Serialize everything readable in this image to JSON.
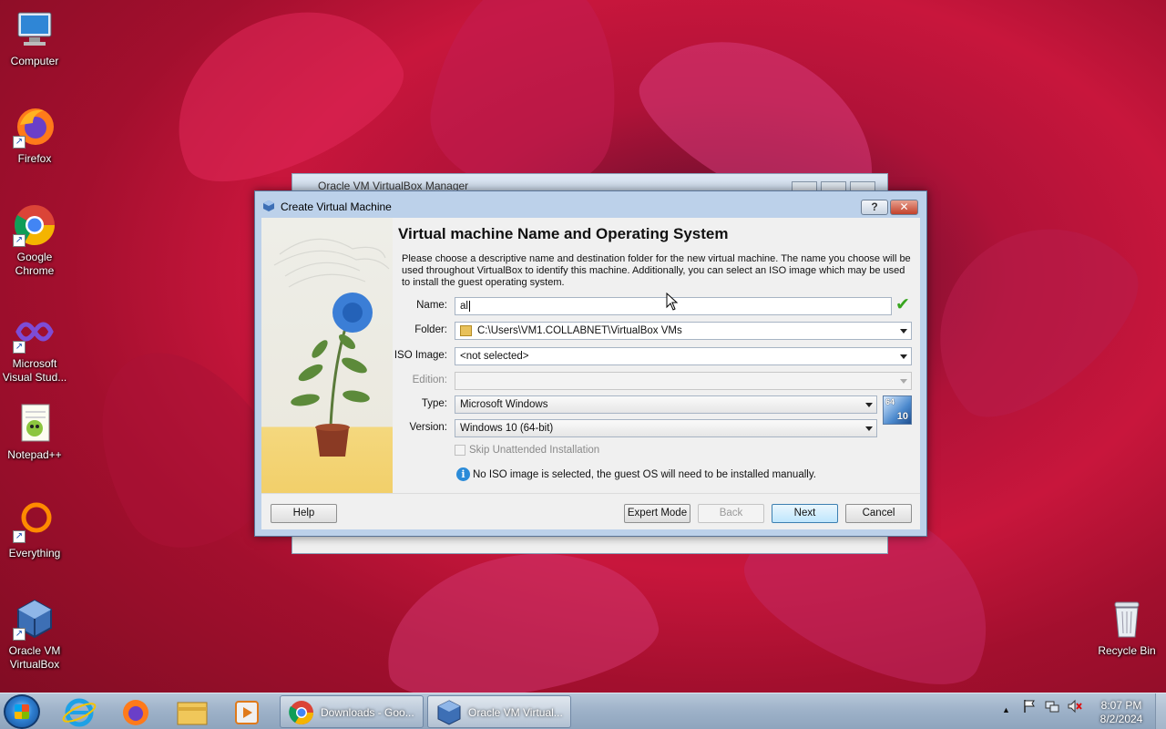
{
  "desktop": {
    "icons": [
      {
        "label": "Computer",
        "icon": "computer-icon"
      },
      {
        "label": "Firefox",
        "icon": "firefox-icon"
      },
      {
        "label": "Google Chrome",
        "icon": "chrome-icon"
      },
      {
        "label": "Microsoft Visual Stud...",
        "icon": "visual-studio-icon"
      },
      {
        "label": "Notepad++",
        "icon": "notepad-plus-plus-icon"
      },
      {
        "label": "Everything",
        "icon": "everything-icon"
      },
      {
        "label": "Oracle VM VirtualBox",
        "icon": "virtualbox-icon"
      },
      {
        "label": "Recycle Bin",
        "icon": "recycle-bin-icon"
      }
    ]
  },
  "background_window": {
    "title": "Oracle VM VirtualBox Manager"
  },
  "dialog": {
    "title": "Create Virtual Machine",
    "help_glyph": "?",
    "close_glyph": "✕",
    "heading": "Virtual machine Name and Operating System",
    "description": "Please choose a descriptive name and destination folder for the new virtual machine. The name you choose will be used throughout VirtualBox to identify this machine. Additionally, you can select an ISO image which may be used to install the guest operating system.",
    "fields": {
      "name_label": "Name:",
      "name_value": "al",
      "folder_label": "Folder:",
      "folder_value": "C:\\Users\\VM1.COLLABNET\\VirtualBox VMs",
      "iso_label": "ISO Image:",
      "iso_value": "<not selected>",
      "edition_label": "Edition:",
      "edition_value": "",
      "type_label": "Type:",
      "type_value": "Microsoft Windows",
      "version_label": "Version:",
      "version_value": "Windows 10 (64-bit)"
    },
    "os_badge": {
      "bits": "64",
      "version": "10"
    },
    "skip_unattended_label": "Skip Unattended Installation",
    "skip_unattended_checked": false,
    "info_message": "No ISO image is selected, the guest OS will need to be installed manually.",
    "buttons": {
      "help": "Help",
      "expert_mode": "Expert Mode",
      "back": "Back",
      "next": "Next",
      "cancel": "Cancel"
    }
  },
  "taskbar": {
    "pinned": [
      "internet-explorer-icon",
      "firefox-icon",
      "file-explorer-icon",
      "media-player-icon"
    ],
    "tasks": [
      {
        "label": "Downloads - Goo...",
        "icon": "chrome-icon"
      },
      {
        "label": "Oracle VM Virtual...",
        "icon": "virtualbox-icon",
        "active": true
      }
    ],
    "tray_expand_glyph": "▲",
    "clock_time": "8:07 PM",
    "clock_date": "8/2/2024"
  }
}
